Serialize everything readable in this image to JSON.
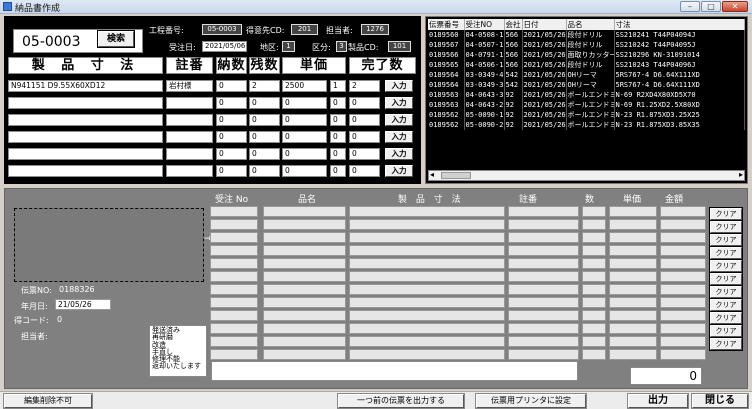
{
  "window": {
    "title": "納品書作成"
  },
  "top": {
    "code": "05-0003",
    "search_label": "検索",
    "koteibango_label": "工程番号:",
    "koteibango_value": "05-0003",
    "tokuisaki_label": "得意先CD:",
    "tokuisaki_value": "201",
    "tantou_label": "担当者:",
    "tantou_value": "1276",
    "juchubi_label": "受注日:",
    "juchubi_value": "2021/05/06",
    "chiku_label": "地区:",
    "chiku_value": "1",
    "kubun_label": "区分:",
    "kubun_value": "3",
    "seihin_label": "製品CD:",
    "seihin_value": "101"
  },
  "form": {
    "headers": [
      "製 品 寸 法",
      "註番",
      "納数",
      "残数",
      "単価",
      "完了数"
    ],
    "enter_label": "入力",
    "rows": [
      {
        "size": "N941151 D9.55X60XD12",
        "chuban": "岩村様",
        "nou": "0",
        "zan": "2",
        "tanka": "2500",
        "x": "1",
        "kanryo": "2"
      },
      {
        "size": "",
        "chuban": "",
        "nou": "0",
        "zan": "0",
        "tanka": "0",
        "x": "0",
        "kanryo": "0"
      },
      {
        "size": "",
        "chuban": "",
        "nou": "0",
        "zan": "0",
        "tanka": "0",
        "x": "0",
        "kanryo": "0"
      },
      {
        "size": "",
        "chuban": "",
        "nou": "0",
        "zan": "0",
        "tanka": "0",
        "x": "0",
        "kanryo": "0"
      },
      {
        "size": "",
        "chuban": "",
        "nou": "0",
        "zan": "0",
        "tanka": "0",
        "x": "0",
        "kanryo": "0"
      },
      {
        "size": "",
        "chuban": "",
        "nou": "0",
        "zan": "0",
        "tanka": "0",
        "x": "0",
        "kanryo": "0"
      }
    ]
  },
  "grid": {
    "headers": [
      "伝票番号",
      "受注NO",
      "会社",
      "日付",
      "品名",
      "寸法"
    ],
    "rows": [
      [
        "0189560",
        "04-0508-1",
        "566",
        "2021/05/26",
        "段付ドリル",
        "SS210241 T44P04094J"
      ],
      [
        "0189567",
        "04-0507-1",
        "566",
        "2021/05/26",
        "段付ドリル",
        "SS210242 T44P04095J"
      ],
      [
        "0189566",
        "04-0791-1",
        "566",
        "2021/05/26",
        "面取りカッター",
        "SS210296 KN-31091014"
      ],
      [
        "0189565",
        "04-0506-1",
        "566",
        "2021/05/26",
        "段付ドリル",
        "SS210243 T44P04096J"
      ],
      [
        "0189564",
        "03-0349-4",
        "542",
        "2021/05/26",
        "OHリーマ",
        "5RS767-4 D6.64X111XD"
      ],
      [
        "0189564",
        "03-0349-3",
        "542",
        "2021/05/26",
        "OHリーマ",
        "5RS767-4 D6.64X111XD"
      ],
      [
        "0189563",
        "04-0643-3",
        "92",
        "2021/05/26",
        "ボールエンドミル",
        "N-69 R2XD4X80XD5X70"
      ],
      [
        "0189563",
        "04-0643-2",
        "92",
        "2021/05/26",
        "ボールエンドミル",
        "N-69 R1.25XD2.5X80XD"
      ],
      [
        "0189562",
        "05-0090-1",
        "92",
        "2021/05/26",
        "ボールエンドミル",
        "N-23 R1.875XD3.25X25"
      ],
      [
        "0189562",
        "05-0090-2",
        "92",
        "2021/05/26",
        "ボールエンドミル",
        "N-23 R1.875XD3.85X35"
      ]
    ]
  },
  "bottom": {
    "headers": {
      "juchu": "受注 No",
      "hinmei": "品名",
      "sunpou": "製 品 寸 法",
      "chuban": "註番",
      "su": "数",
      "tanka": "単価",
      "kingaku": "金額"
    },
    "clear_label": "クリア",
    "denpyo_label": "伝票NO:",
    "denpyo_value": "0188326",
    "date_label": "年月日:",
    "date_value": "21/05/26",
    "tokui_label": "得コード:",
    "tokui_value": "0",
    "tantou_label": "担当者:",
    "status_options": [
      "発送済み",
      "再研磨",
      "改造",
      "手直し",
      "修理不能",
      "返却いたします"
    ],
    "total": "0"
  },
  "statusbar": {
    "edit_lock": "編集削除不可",
    "prev_print": "一つ前の伝票を出力する",
    "printer_setting": "伝票用プリンタに設定",
    "output": "出力",
    "close": "閉じる"
  }
}
